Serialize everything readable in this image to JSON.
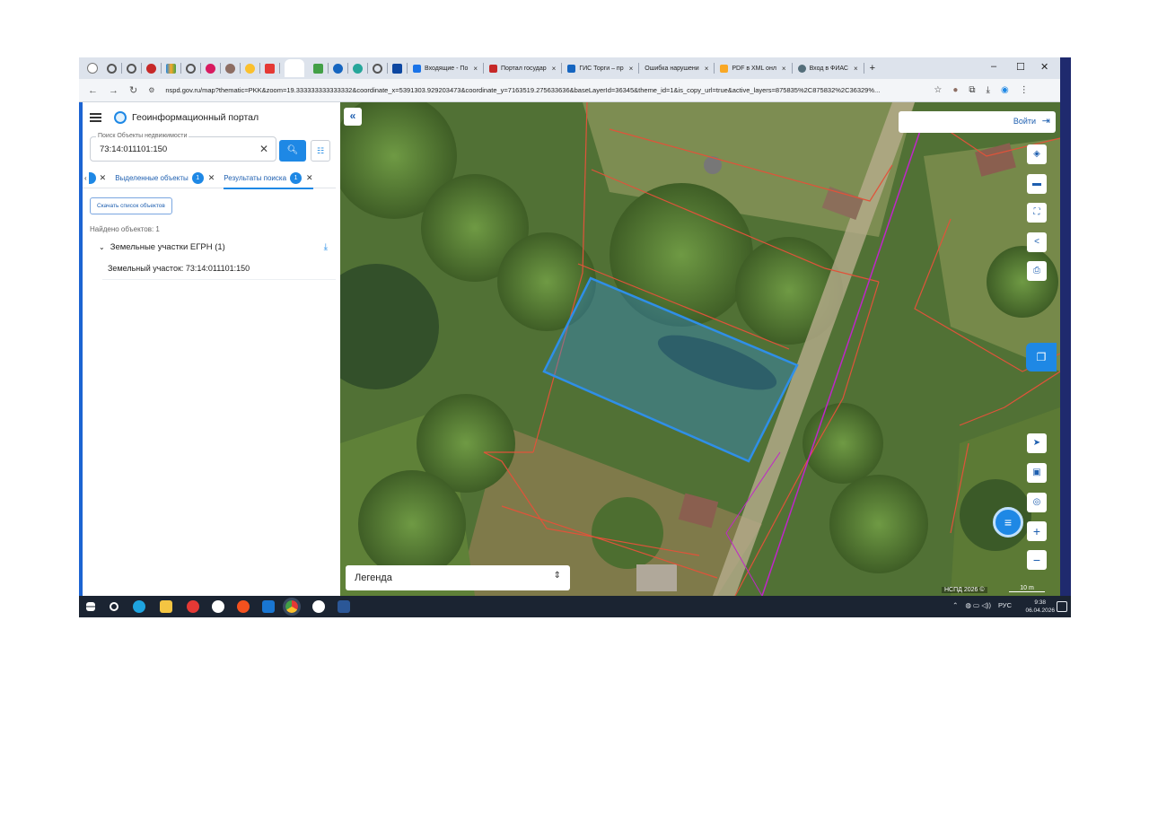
{
  "browser": {
    "tabs": [
      {
        "label": "Входящие - По",
        "color": "#1a73e8"
      },
      {
        "label": "Портал государ",
        "color": "#c62828"
      },
      {
        "label": "ГИС Торги – пр",
        "color": "#1565c0"
      },
      {
        "label": "Ошибка нарушени",
        "color": "#888888"
      },
      {
        "label": "PDF в XML онл",
        "color": "#f9a825"
      },
      {
        "label": "Вход в ФИАС",
        "color": "#546e7a"
      }
    ],
    "tab_close_glyph": "×",
    "new_tab": "+",
    "address": {
      "url": "nspd.gov.ru/map?thematic=PKK&zoom=19.333333333333332&coordinate_x=5391303.929203473&coordinate_y=7163519.275633636&baseLayerId=36345&theme_id=1&is_copy_url=true&active_layers=875835%2C875832%2C36329%..."
    }
  },
  "sidebar": {
    "title": "Геоинформационный портал",
    "search": {
      "legend": "Поиск Объекты недвижимости",
      "value": "73:14:011101:150"
    },
    "tabs": [
      {
        "label": "Выделенные объекты",
        "badge": "1"
      },
      {
        "label": "Результаты поиска",
        "badge": "1"
      }
    ],
    "download_list": "Скачать список объектов",
    "found": "Найдено объектов: 1",
    "group": {
      "label": "Земельные участки ЕГРН (1)"
    },
    "result": "Земельный участок: 73:14:011101:150"
  },
  "map": {
    "login": "Войти",
    "legend": "Легенда",
    "copyright": "НСПД 2026 ©",
    "scale": "10 m",
    "colors": {
      "parcel": "#2f8fe8",
      "boundary": "#e0533a",
      "road": "#c026c9"
    }
  },
  "taskbar": {
    "lang": "РУС",
    "time": "9:38",
    "date": "06.04.2026"
  }
}
